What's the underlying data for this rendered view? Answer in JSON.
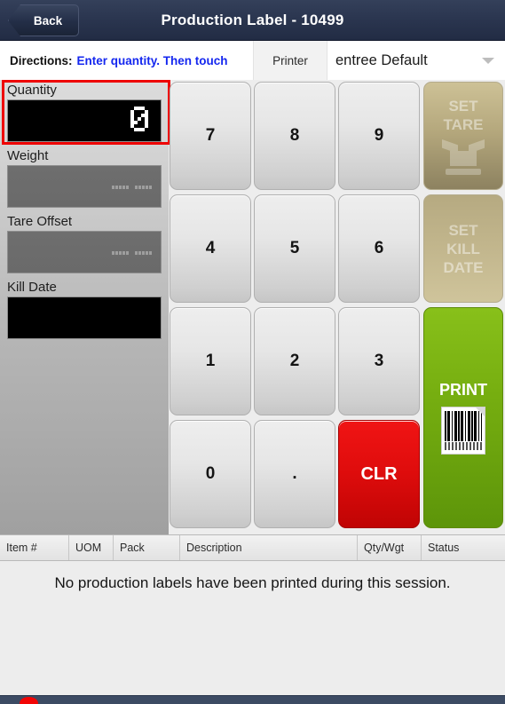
{
  "titlebar": {
    "back_label": "Back",
    "title": "Production Label - 10499"
  },
  "directions": {
    "label": "Directions:",
    "text": "Enter quantity. Then touch",
    "printer_label": "Printer",
    "printer_value": "entree Default",
    "caret_icon": "chevron-down-icon"
  },
  "fields": [
    {
      "label": "Quantity",
      "value": "0",
      "state": "active",
      "highlighted": true
    },
    {
      "label": "Weight",
      "value": "",
      "state": "disabled",
      "highlighted": false
    },
    {
      "label": "Tare Offset",
      "value": "",
      "state": "disabled",
      "highlighted": false
    },
    {
      "label": "Kill Date",
      "value": "",
      "state": "active",
      "highlighted": false
    }
  ],
  "keypad": {
    "keys": [
      "7",
      "8",
      "9",
      "4",
      "5",
      "6",
      "1",
      "2",
      "3",
      "0",
      ".",
      "CLR"
    ],
    "clear_label": "CLR"
  },
  "actions": {
    "set_tare": {
      "line1": "SET",
      "line2": "TARE",
      "icon": "box-on-scale-icon",
      "enabled": false
    },
    "set_kill_date": {
      "line1": "SET",
      "line2": "KILL",
      "line3": "DATE",
      "enabled": false
    },
    "print": {
      "label": "PRINT",
      "icon": "barcode-label-icon",
      "enabled": true
    }
  },
  "table": {
    "columns": [
      "Item #",
      "UOM",
      "Pack",
      "Description",
      "Qty/Wgt",
      "Status"
    ],
    "empty_message": "No production labels have been printed during this session.",
    "rows": []
  },
  "colors": {
    "titlebar": "#2b3650",
    "directions_link": "#1427ef",
    "highlight_border": "#ee0000",
    "clear_button": "#e00d0d",
    "print_button": "#76ae10",
    "disabled_action": "#b5a87d",
    "bottom_bar": "#3c4b63",
    "status_dot": "#f20505"
  }
}
